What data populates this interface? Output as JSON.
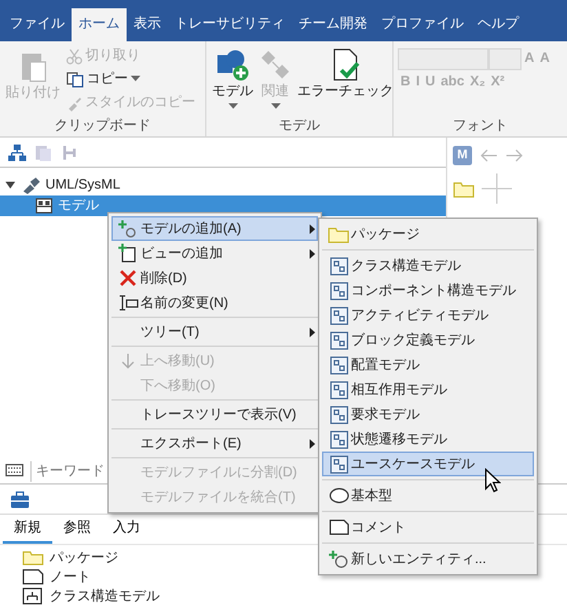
{
  "ribbon_tabs": [
    {
      "label": "ファイル",
      "selected": false
    },
    {
      "label": "ホーム",
      "selected": true
    },
    {
      "label": "表示",
      "selected": false
    },
    {
      "label": "トレーサビリティ",
      "selected": false
    },
    {
      "label": "チーム開発",
      "selected": false
    },
    {
      "label": "プロファイル",
      "selected": false
    },
    {
      "label": "ヘルプ",
      "selected": false
    }
  ],
  "ribbon": {
    "groups": [
      {
        "kind": "clipboard",
        "label": "クリップボード",
        "buttons": [
          {
            "label": "貼り付け",
            "disabled": true,
            "dropdown": false
          },
          {
            "label": "切り取り",
            "disabled": true,
            "dropdown": false
          },
          {
            "label": "コピー",
            "disabled": false,
            "dropdown": true
          },
          {
            "label": "スタイルのコピー",
            "disabled": true,
            "dropdown": false
          }
        ]
      },
      {
        "kind": "model",
        "label": "モデル",
        "buttons": [
          {
            "label": "モデル",
            "disabled": false,
            "dropdown": true
          },
          {
            "label": "関連",
            "disabled": true,
            "dropdown": true
          },
          {
            "label": "エラーチェック",
            "disabled": false,
            "dropdown": false
          }
        ]
      },
      {
        "kind": "font",
        "label": "フォント",
        "buttons": [
          {
            "label": "A",
            "disabled": true
          },
          {
            "label": "A",
            "disabled": true
          },
          {
            "label": "B",
            "disabled": true
          },
          {
            "label": "I",
            "disabled": true
          },
          {
            "label": "U",
            "disabled": true
          },
          {
            "label": "abc",
            "disabled": true
          },
          {
            "label": "X₂",
            "disabled": true
          },
          {
            "label": "X²",
            "disabled": true
          }
        ]
      }
    ]
  },
  "tree": [
    {
      "label": "UML/SysML",
      "expanded": true,
      "selected": false,
      "children": [
        {
          "label": "モデル",
          "selected": true
        }
      ]
    }
  ],
  "side_panel": {
    "badge": "M"
  },
  "search": {
    "placeholder": "キーワード"
  },
  "toolbox": {
    "tabs": [
      {
        "label": "新規",
        "selected": true
      },
      {
        "label": "参照",
        "selected": false
      },
      {
        "label": "入力",
        "selected": false
      }
    ],
    "items": [
      {
        "label": "パッケージ"
      },
      {
        "label": "ノート"
      },
      {
        "label": "クラス構造モデル"
      }
    ]
  },
  "context_menu": {
    "items": [
      {
        "kind": "item",
        "label": "モデルの追加(A)",
        "selected": true,
        "disabled": false,
        "submenu": true
      },
      {
        "kind": "item",
        "label": "ビューの追加",
        "selected": false,
        "disabled": false,
        "submenu": true
      },
      {
        "kind": "item",
        "label": "削除(D)",
        "selected": false,
        "disabled": false,
        "submenu": false
      },
      {
        "kind": "item",
        "label": "名前の変更(N)",
        "selected": false,
        "disabled": false,
        "submenu": false
      },
      {
        "kind": "separator"
      },
      {
        "kind": "item",
        "label": "ツリー(T)",
        "selected": false,
        "disabled": false,
        "submenu": true
      },
      {
        "kind": "separator"
      },
      {
        "kind": "item",
        "label": "上へ移動(U)",
        "selected": false,
        "disabled": true,
        "submenu": false
      },
      {
        "kind": "item",
        "label": "下へ移動(O)",
        "selected": false,
        "disabled": true,
        "submenu": false
      },
      {
        "kind": "separator"
      },
      {
        "kind": "item",
        "label": "トレースツリーで表示(V)",
        "selected": false,
        "disabled": false,
        "submenu": false
      },
      {
        "kind": "separator"
      },
      {
        "kind": "item",
        "label": "エクスポート(E)",
        "selected": false,
        "disabled": false,
        "submenu": true
      },
      {
        "kind": "separator"
      },
      {
        "kind": "item",
        "label": "モデルファイルに分割(D)",
        "selected": false,
        "disabled": true,
        "submenu": false
      },
      {
        "kind": "item",
        "label": "モデルファイルを統合(T)",
        "selected": false,
        "disabled": true,
        "submenu": false
      }
    ]
  },
  "submenu": {
    "items": [
      {
        "kind": "item",
        "label": "パッケージ",
        "selected": false
      },
      {
        "kind": "separator"
      },
      {
        "kind": "item",
        "label": "クラス構造モデル",
        "selected": false
      },
      {
        "kind": "item",
        "label": "コンポーネント構造モデル",
        "selected": false
      },
      {
        "kind": "item",
        "label": "アクティビティモデル",
        "selected": false
      },
      {
        "kind": "item",
        "label": "ブロック定義モデル",
        "selected": false
      },
      {
        "kind": "item",
        "label": "配置モデル",
        "selected": false
      },
      {
        "kind": "item",
        "label": "相互作用モデル",
        "selected": false
      },
      {
        "kind": "item",
        "label": "要求モデル",
        "selected": false
      },
      {
        "kind": "item",
        "label": "状態遷移モデル",
        "selected": false
      },
      {
        "kind": "item",
        "label": "ユースケースモデル",
        "selected": true
      },
      {
        "kind": "separator"
      },
      {
        "kind": "item",
        "label": "基本型",
        "selected": false
      },
      {
        "kind": "separator"
      },
      {
        "kind": "item",
        "label": "コメント",
        "selected": false
      },
      {
        "kind": "separator"
      },
      {
        "kind": "item",
        "label": "新しいエンティティ...",
        "selected": false
      }
    ]
  }
}
